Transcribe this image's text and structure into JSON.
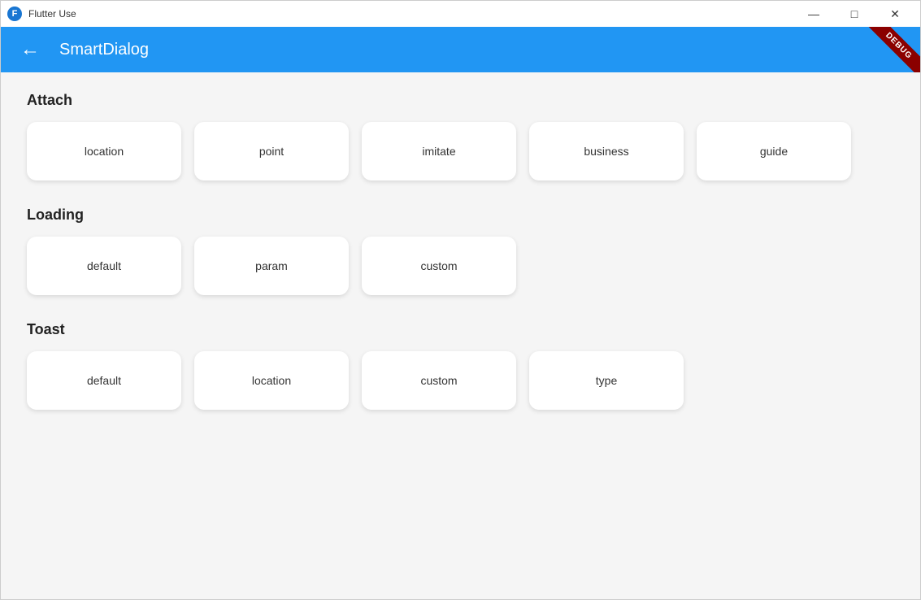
{
  "window": {
    "title": "Flutter Use",
    "app_icon": "flutter-icon"
  },
  "title_bar": {
    "controls": {
      "minimize_label": "—",
      "maximize_label": "□",
      "close_label": "✕"
    }
  },
  "header": {
    "back_label": "←",
    "title": "SmartDialog",
    "debug_label": "DEBUG"
  },
  "sections": [
    {
      "id": "attach",
      "title": "Attach",
      "buttons": [
        {
          "label": "location"
        },
        {
          "label": "point"
        },
        {
          "label": "imitate"
        },
        {
          "label": "business"
        },
        {
          "label": "guide"
        }
      ]
    },
    {
      "id": "loading",
      "title": "Loading",
      "buttons": [
        {
          "label": "default"
        },
        {
          "label": "param"
        },
        {
          "label": "custom"
        }
      ]
    },
    {
      "id": "toast",
      "title": "Toast",
      "buttons": [
        {
          "label": "default"
        },
        {
          "label": "location"
        },
        {
          "label": "custom"
        },
        {
          "label": "type"
        }
      ]
    }
  ]
}
